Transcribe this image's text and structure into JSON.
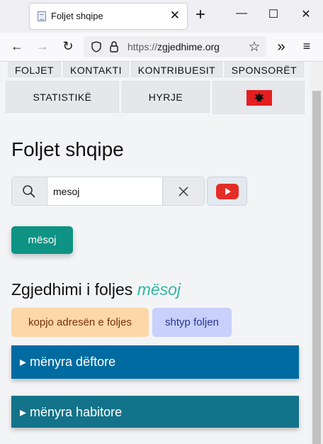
{
  "browser": {
    "tab_title": "Foljet shqipe",
    "url_host": "https://zgjedhime.org",
    "new_tab_symbol": "+",
    "tab_close_symbol": "✕"
  },
  "site_nav": {
    "row1": [
      "FOLJET",
      "KONTAKTI",
      "KONTRIBUESIT",
      "SPONSORËT"
    ],
    "row2": [
      "STATISTIKË",
      "HYRJE"
    ],
    "flag_icon": "albanian-flag-icon"
  },
  "page": {
    "heading": "Foljet shqipe",
    "search": {
      "value": "mesoj",
      "search_icon": "search-icon",
      "clear_icon": "close-icon"
    },
    "youtube_icon": "youtube-icon",
    "verb_button": "mësoj",
    "conjugation_title": "Zgjedhimi i foljes",
    "conjugation_verb": "mësoj",
    "copy_button": "kopjo adresën e foljes",
    "print_button": "shtyp foljen",
    "sections": [
      {
        "label": "▸ mënyra dëftore",
        "color": "#006ba1"
      },
      {
        "label": "▸ mënyra habitore",
        "color": "#13738a"
      }
    ]
  },
  "colors": {
    "accent": "#0e9384",
    "verb_highlight": "#2fb7a4",
    "copy_chip_bg": "#fdd7a7",
    "print_chip_bg": "#c8d0fb"
  }
}
